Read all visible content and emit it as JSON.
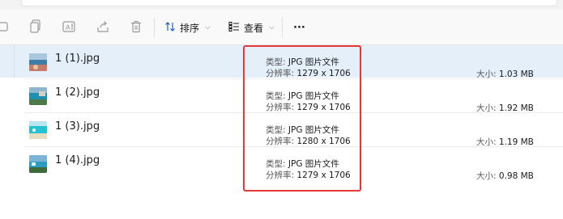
{
  "toolbar": {
    "sort_label": "排序",
    "view_label": "查看",
    "more_label": "···"
  },
  "files": [
    {
      "name": "1 (1).jpg",
      "type_label": "类型:",
      "type_value": "JPG 图片文件",
      "res_label": "分辨率:",
      "res_value": "1279 x 1706",
      "size_label": "大小:",
      "size_value": "1.03 MB",
      "selected": true
    },
    {
      "name": "1 (2).jpg",
      "type_label": "类型:",
      "type_value": "JPG 图片文件",
      "res_label": "分辨率:",
      "res_value": "1279 x 1706",
      "size_label": "大小:",
      "size_value": "1.92 MB",
      "selected": false
    },
    {
      "name": "1 (3).jpg",
      "type_label": "类型:",
      "type_value": "JPG 图片文件",
      "res_label": "分辨率:",
      "res_value": "1280 x 1706",
      "size_label": "大小:",
      "size_value": "1.19 MB",
      "selected": false
    },
    {
      "name": "1 (4).jpg",
      "type_label": "类型:",
      "type_value": "JPG 图片文件",
      "res_label": "分辨率:",
      "res_value": "1279 x 1706",
      "size_label": "大小:",
      "size_value": "0.98 MB",
      "selected": false
    }
  ],
  "colors": {
    "selection": "#e4effa",
    "highlight_box": "#e53935"
  }
}
